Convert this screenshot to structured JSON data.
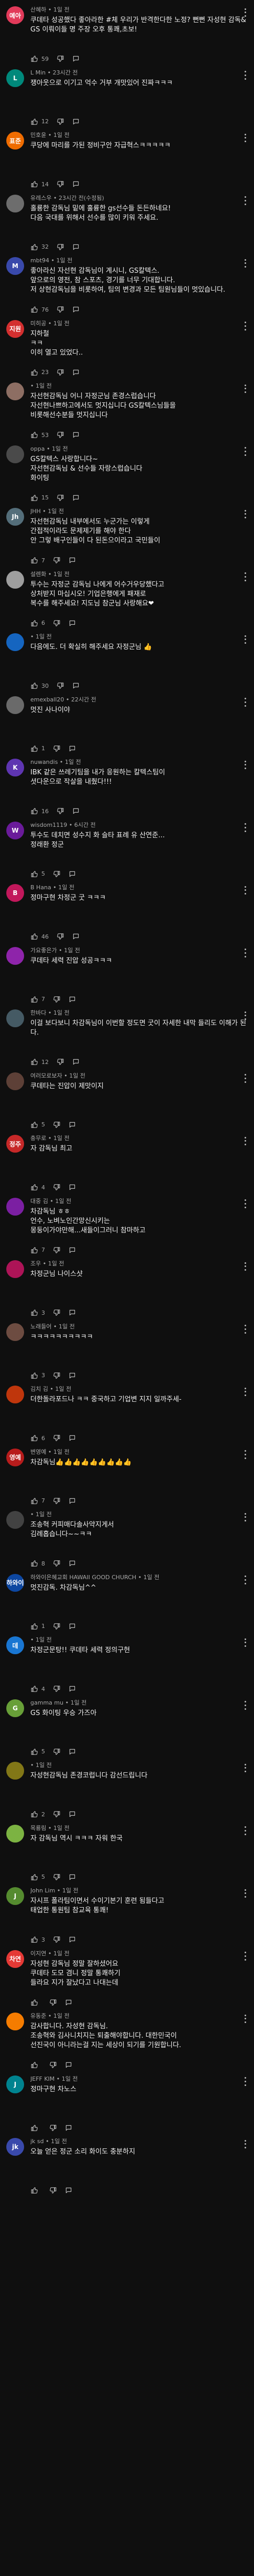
{
  "comments": [
    {
      "author": "산혜하",
      "time": "1일 전",
      "text": "쿠데타 성공했다 좋아라한 #체 우리가 반격한다한 노정? 뻔뻔 자성현 감독& GS 이뤄이들 명 주장 오후 통쾌,초보!",
      "likes": "59",
      "avatar_text": "예아",
      "avatar_color": "#e23a5a"
    },
    {
      "author": "L Min",
      "time": "23시간 전",
      "text": "쟁아웃으로 이기고 억수 거부 개맛있어 진짜ㅋㅋㅋ",
      "likes": "12",
      "avatar_text": "L",
      "avatar_color": "#00897b"
    },
    {
      "author": "민호윤",
      "time": "1일 전",
      "text": "쿠당에 마리를 가된 정비구안 자급혁스ㅋㅋㅋㅋㅋ",
      "likes": "14",
      "avatar_text": "표준",
      "avatar_color": "#ef6c00"
    },
    {
      "author": "유레스우",
      "time": "23시간 전(수정됨)",
      "text": "홀룡한 감독님 밑에 훌륭한 gs선수들 돈든하네요!\n다음 국대를 위해서 선수를 많이 키워 주세요.",
      "likes": "32",
      "avatar_text": "",
      "avatar_color": "#6d6d6d"
    },
    {
      "author": "mbt94",
      "time": "1일 전",
      "text": "좋아라신 자선현 감독님이 계시니, GS칼텍스.\n앞으로의 영전, 참 스포츠, 경기를 너무 기대합니다.\n저 상현감독님을 비롯하여, 팀의 변경과 모든 팀원님들이 멋있습니다.",
      "likes": "76",
      "avatar_text": "M",
      "avatar_color": "#3949ab"
    },
    {
      "author": "미히공",
      "time": "1일 전",
      "text": "지하철\nㅋㅋ\n이히 열고 있었다..",
      "likes": "23",
      "avatar_text": "지원",
      "avatar_color": "#d32f2f"
    },
    {
      "author": "",
      "time": "1일 전",
      "text": "자선현감독님 어니 자정군님 존경스럽습니다\n자선현나쁘하고에서도 멋지십니다 GS칼텍스님들을\n비롯해선수분들 멋지십니다",
      "likes": "53",
      "avatar_text": "",
      "avatar_color": "#8d6e63"
    },
    {
      "author": "oppa",
      "time": "1일 전",
      "text": "GS칼텍스 사랑합니다~\n자선현감독님 & 선수들 자랑스럽습니다\n화이팅\n오늘경기 잘했어요\n내가서라라라도 캐박살 해줬어 ㅋㅋ...",
      "likes": "15",
      "avatar_text": "",
      "avatar_color": "#4a4a4a"
    },
    {
      "author": "JHH",
      "time": "1일 전",
      "text": "자선현감독님 내부에서도 누군가는 이렇게\n간접적이라도 문제제기를 해야 한다\n안 그렇 배구인들이 다 된돈으이라고 국민들이\n오해할수도 있기 때문",
      "likes": "7",
      "avatar_text": "Jh",
      "avatar_color": "#546e7a"
    },
    {
      "author": "설렌화",
      "time": "1일 전",
      "text": "투수는 자정군 감독님 나에게 어수거우당했다고\n상처받지 마십시오! 기업은행에게 패재로\n복수를 해주세요! 지도님 참군님 사랑해요❤",
      "likes": "6",
      "avatar_text": "",
      "avatar_color": "#9e9e9e"
    },
    {
      "author": "",
      "time": "1일 전",
      "text": "다음에도. 더 확실히 해주세요 자정군님 👍",
      "likes": "30",
      "avatar_text": "",
      "avatar_color": "#1565c0"
    },
    {
      "author": "emexball20",
      "time": "22시간 전",
      "text": "멋진 사나이야",
      "likes": "1",
      "avatar_text": "",
      "avatar_color": "#6a6a6a"
    },
    {
      "author": "nuwandis",
      "time": "1일 전",
      "text": "IBK 같은 쓰레기팀을 내가 응원하는 칼텍스팀이\n셧다운으로 작살을 내줬다!!!",
      "likes": "16",
      "avatar_text": "K",
      "avatar_color": "#5e35b1"
    },
    {
      "author": "wisdom1119",
      "time": "6시간 전",
      "text": "투수도 데치면 성수지 화 슬타 표례 유 산연준...\n정래환 정군",
      "likes": "5",
      "avatar_text": "W",
      "avatar_color": "#6a1b9a"
    },
    {
      "author": "B Hana",
      "time": "1일 전",
      "text": "정마구현 차정군 굿 ㅋㅋㅋ",
      "likes": "46",
      "avatar_text": "B",
      "avatar_color": "#c2185b"
    },
    {
      "author": "가요좋은가",
      "time": "1일 전",
      "text": "쿠데타 세력 진압 성공ㅋㅋㅋ",
      "likes": "7",
      "avatar_text": "",
      "avatar_color": "#8e24aa"
    },
    {
      "author": "한바다",
      "time": "1일 전",
      "text": "이걸 보다보니 차감독님이 이번할 정도면 굿이 자세한 내막 들리도 이해가 된다.",
      "likes": "12",
      "avatar_text": "",
      "avatar_color": "#455a64"
    },
    {
      "author": "여러모로보자",
      "time": "1일 전",
      "text": "쿠데타는 진압이 제맛이지",
      "likes": "5",
      "avatar_text": "",
      "avatar_color": "#5d4037"
    },
    {
      "author": "충무로",
      "time": "1일 전",
      "text": "자 감독님 최고",
      "likes": "4",
      "avatar_text": "정주",
      "avatar_color": "#c62828"
    },
    {
      "author": "대중 김",
      "time": "1일 전",
      "text": "차감독님 ㅎㅎ\n언수, 노벼노인간망신시키는\n몽둥이가야만해...새들이그러니 참마하고",
      "likes": "7",
      "avatar_text": "",
      "avatar_color": "#7b1fa2"
    },
    {
      "author": "조우",
      "time": "1일 전",
      "text": "차정군님 나이스샷",
      "likes": "3",
      "avatar_text": "",
      "avatar_color": "#ad1457"
    },
    {
      "author": "노래들어",
      "time": "1일 전",
      "text": "ㅋㅋㅋㅋㅋㅋㅋㅋㅋㅋ",
      "likes": "3",
      "avatar_text": "",
      "avatar_color": "#6d4c41"
    },
    {
      "author": "김치 김",
      "time": "1일 전",
      "text": "더한돌라포드나 ㅋㅋ 중국하고 기업변 지지 일까주세-",
      "likes": "6",
      "avatar_text": "",
      "avatar_color": "#bf360c"
    },
    {
      "author": "변영예",
      "time": "1일 전",
      "text": "차감독님👍👍👍👍👍👍👍👍👍",
      "likes": "7",
      "avatar_text": "영예",
      "avatar_color": "#b71c1c"
    },
    {
      "author": "",
      "time": "1일 전",
      "text": "조송혁 커피매다솔사약지게서\n김례홉습니다~~ㅋㅋ",
      "likes": "8",
      "avatar_text": "",
      "avatar_color": "#424242"
    },
    {
      "author": "하와이은혜교회 HAWAII GOOD CHURCH",
      "time": "1일 전",
      "text": "멋진감독. 차감독님^^",
      "likes": "1",
      "avatar_text": "하와이",
      "avatar_color": "#0d47a1"
    },
    {
      "author": "",
      "time": "1일 전",
      "text": "차정군문탕!! 쿠데타 세력 정의구현",
      "likes": "4",
      "avatar_text": "데",
      "avatar_color": "#1976d2"
    },
    {
      "author": "gamma mu",
      "time": "1일 전",
      "text": "GS 화이팅 우승 가즈아",
      "likes": "5",
      "avatar_text": "G",
      "avatar_color": "#689f38"
    },
    {
      "author": "",
      "time": "1일 전",
      "text": "자성현감독님 존경코럽니다 감선드립니다",
      "likes": "2",
      "avatar_text": "",
      "avatar_color": "#827717"
    },
    {
      "author": "목룡림",
      "time": "1일 전",
      "text": "자 감독님 역시 ㅋㅋㅋ 자워 한국",
      "likes": "5",
      "avatar_text": "",
      "avatar_color": "#7cb342"
    },
    {
      "author": "John Lim",
      "time": "1일 전",
      "text": "자시프 폴라팀이면서 수이기본기 훈련 됨들다고\n태업한 통원팀 참교육 통쾌!",
      "likes": "3",
      "avatar_text": "J",
      "avatar_color": "#558b2f"
    },
    {
      "author": "이지연",
      "time": "1일 전",
      "text": "자성현 감독님 정말 잘하셨어요\n쿠데타 도모 겸니 정말 통쾌하기\n들라요 지가 잘났다고 나대는데\n정질을 보여주셔서 감사합니다",
      "likes": "",
      "avatar_text": "차연",
      "avatar_color": "#e53935"
    },
    {
      "author": "유동준",
      "time": "1일 전",
      "text": "감사합니다. 자성현 감독님.\n조송혁와 김사니치지는 퇴출해야합니다. 대한민국이\n선진국이 아니라는걸 지는 세상이 되기를 기원합니다.",
      "likes": "",
      "avatar_text": "",
      "avatar_color": "#f57c00"
    },
    {
      "author": "JEFF KIM",
      "time": "1일 전",
      "text": "정마구현 차노스",
      "likes": "",
      "avatar_text": "J",
      "avatar_color": "#00838f"
    },
    {
      "author": "jk sd",
      "time": "1일 전",
      "text": "오늘 얻은 정군 소리 화이도 충분하지",
      "likes": "",
      "avatar_text": "jk",
      "avatar_color": "#3949ab"
    }
  ],
  "icons": {
    "like": "thumb-up-icon",
    "dislike": "thumb-down-icon",
    "reply": "comment-reply-icon",
    "more": "more-vert-icon"
  }
}
